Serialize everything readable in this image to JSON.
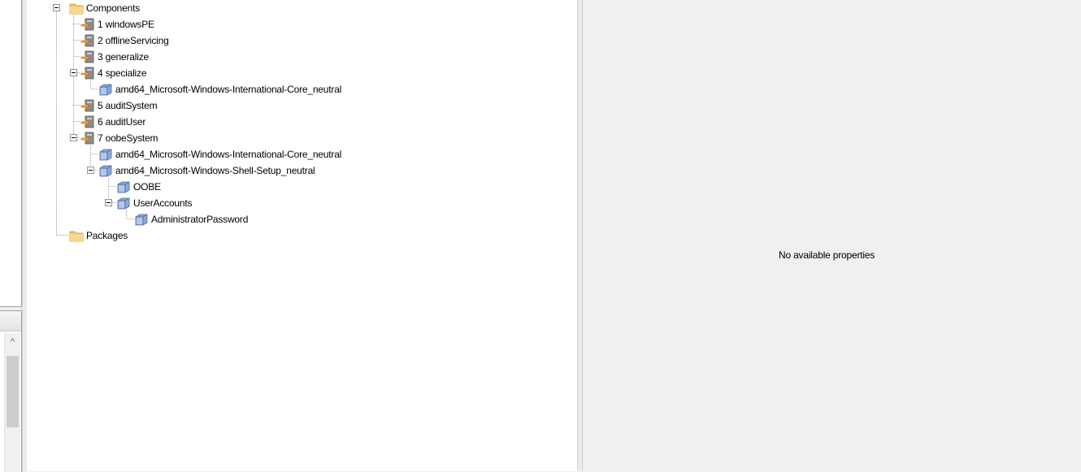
{
  "tree": {
    "root": {
      "label": "Components",
      "icon": "folder-icon"
    },
    "items": [
      {
        "label": "1 windowsPE",
        "icon": "pass-icon"
      },
      {
        "label": "2 offlineServicing",
        "icon": "pass-icon"
      },
      {
        "label": "3 generalize",
        "icon": "pass-icon"
      },
      {
        "label": "4 specialize",
        "icon": "pass-icon"
      },
      {
        "label": "amd64_Microsoft-Windows-International-Core_neutral",
        "icon": "component-icon"
      },
      {
        "label": "5 auditSystem",
        "icon": "pass-icon"
      },
      {
        "label": "6 auditUser",
        "icon": "pass-icon"
      },
      {
        "label": "7 oobeSystem",
        "icon": "pass-icon"
      },
      {
        "label": "amd64_Microsoft-Windows-International-Core_neutral",
        "icon": "component-icon"
      },
      {
        "label": "amd64_Microsoft-Windows-Shell-Setup_neutral",
        "icon": "component-icon"
      },
      {
        "label": "OOBE",
        "icon": "component-icon"
      },
      {
        "label": "UserAccounts",
        "icon": "component-icon"
      },
      {
        "label": "AdministratorPassword",
        "icon": "component-icon"
      },
      {
        "label": "Packages",
        "icon": "folder-icon"
      }
    ]
  },
  "properties": {
    "empty_message": "No available properties"
  },
  "scrollbar": {
    "up_arrow": "^"
  }
}
